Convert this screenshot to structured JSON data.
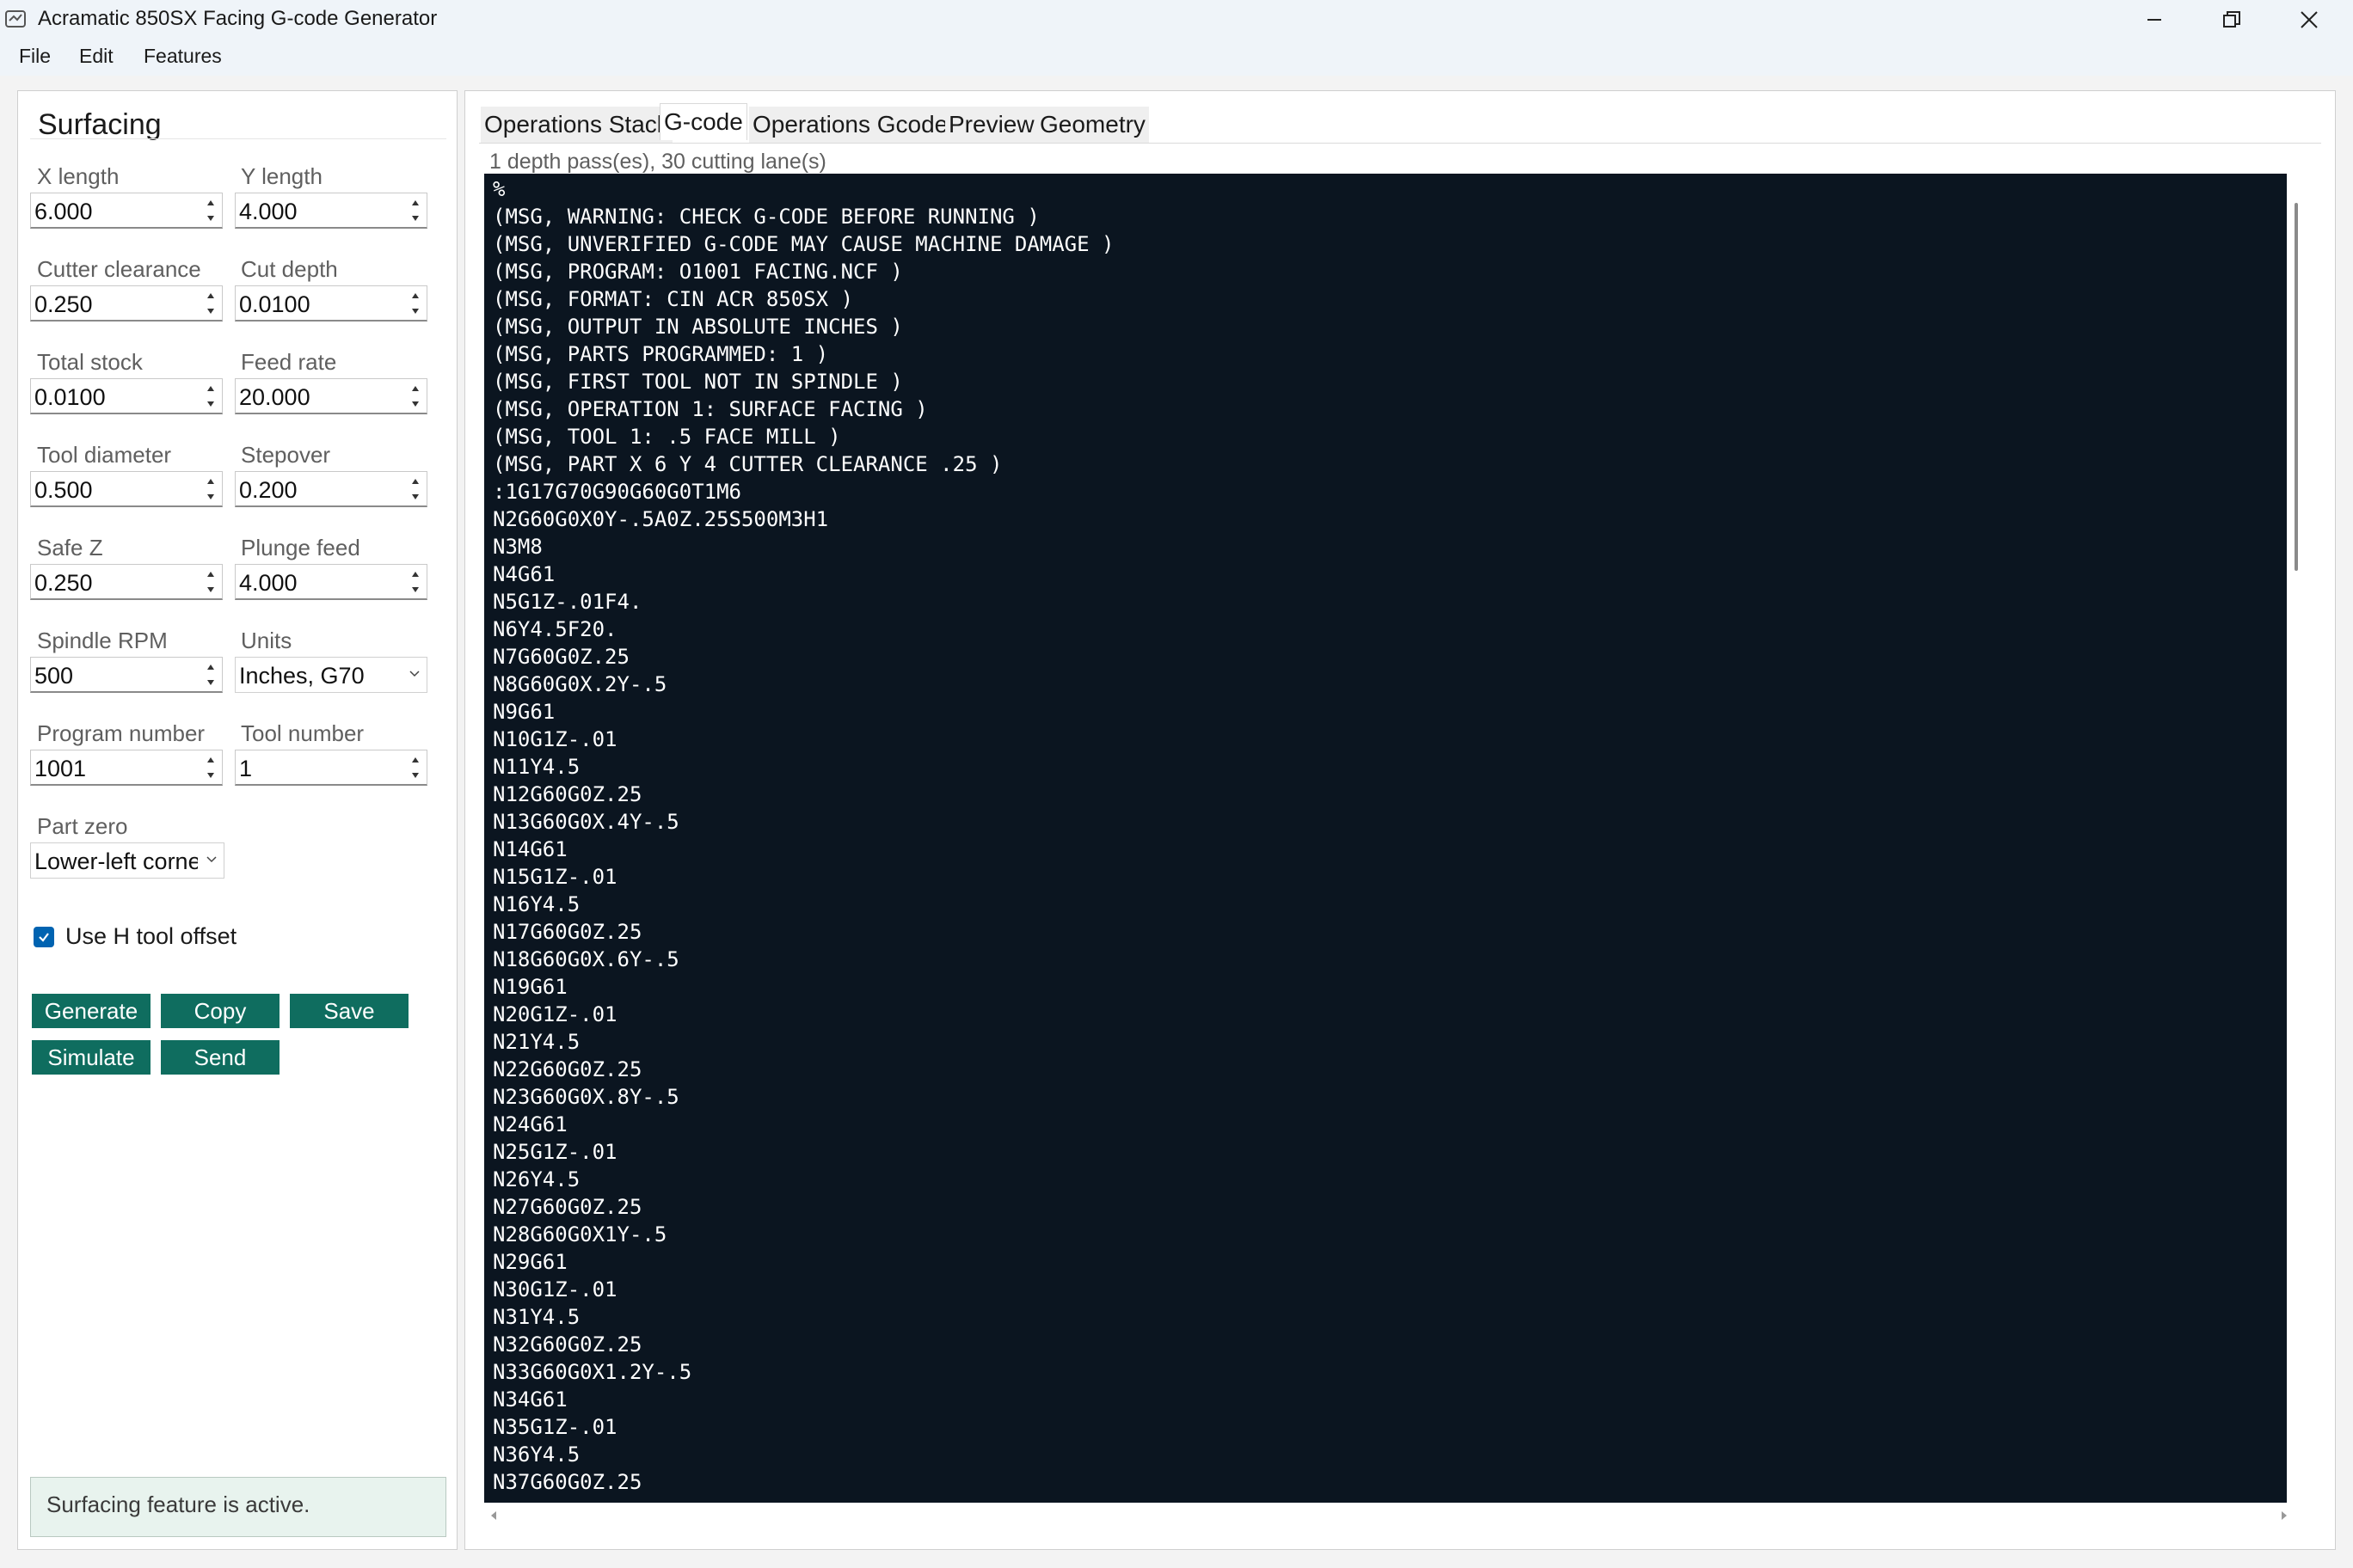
{
  "window": {
    "title": "Acramatic 850SX Facing G-code Generator",
    "controls": [
      "minimize-icon",
      "restore-icon",
      "close-icon"
    ]
  },
  "menu": [
    "File",
    "Edit",
    "Features"
  ],
  "left_panel": {
    "title": "Surfacing",
    "fields": {
      "x_length": {
        "label": "X length",
        "value": "6.000"
      },
      "y_length": {
        "label": "Y length",
        "value": "4.000"
      },
      "cutter_clearance": {
        "label": "Cutter clearance",
        "value": "0.250"
      },
      "cut_depth": {
        "label": "Cut depth",
        "value": "0.0100"
      },
      "total_stock": {
        "label": "Total stock",
        "value": "0.0100"
      },
      "feed_rate": {
        "label": "Feed rate",
        "value": "20.000"
      },
      "tool_diameter": {
        "label": "Tool diameter",
        "value": "0.500"
      },
      "stepover": {
        "label": "Stepover",
        "value": "0.200"
      },
      "safe_z": {
        "label": "Safe Z",
        "value": "0.250"
      },
      "plunge_feed": {
        "label": "Plunge feed",
        "value": "4.000"
      },
      "spindle_rpm": {
        "label": "Spindle RPM",
        "value": "500"
      },
      "units": {
        "label": "Units",
        "value": "Inches, G70"
      },
      "program_number": {
        "label": "Program number",
        "value": "1001"
      },
      "tool_number": {
        "label": "Tool number",
        "value": "1"
      },
      "part_zero": {
        "label": "Part zero",
        "value": "Lower-left corner"
      }
    },
    "use_h_offset": {
      "label": "Use H tool offset",
      "checked": true
    },
    "buttons": {
      "generate": "Generate",
      "copy": "Copy",
      "save": "Save",
      "simulate": "Simulate",
      "send": "Send"
    },
    "status": "Surfacing feature is active."
  },
  "right_panel": {
    "tabs": [
      "Operations Stack",
      "G-code",
      "Operations Gcode",
      "Preview",
      "Geometry"
    ],
    "active_tab": "G-code",
    "info": "1 depth pass(es), 30 cutting lane(s)",
    "gcode_lines": [
      "%",
      "(MSG, WARNING: CHECK G-CODE BEFORE RUNNING )",
      "(MSG, UNVERIFIED G-CODE MAY CAUSE MACHINE DAMAGE )",
      "(MSG, PROGRAM: O1001 FACING.NCF )",
      "(MSG, FORMAT: CIN ACR 850SX )",
      "(MSG, OUTPUT IN ABSOLUTE INCHES )",
      "(MSG, PARTS PROGRAMMED: 1 )",
      "(MSG, FIRST TOOL NOT IN SPINDLE )",
      "(MSG, OPERATION 1: SURFACE FACING )",
      "(MSG, TOOL 1: .5 FACE MILL )",
      "(MSG, PART X 6 Y 4 CUTTER CLEARANCE .25 )",
      ":1G17G70G90G60G0T1M6",
      "N2G60G0X0Y-.5A0Z.25S500M3H1",
      "N3M8",
      "N4G61",
      "N5G1Z-.01F4.",
      "N6Y4.5F20.",
      "N7G60G0Z.25",
      "N8G60G0X.2Y-.5",
      "N9G61",
      "N10G1Z-.01",
      "N11Y4.5",
      "N12G60G0Z.25",
      "N13G60G0X.4Y-.5",
      "N14G61",
      "N15G1Z-.01",
      "N16Y4.5",
      "N17G60G0Z.25",
      "N18G60G0X.6Y-.5",
      "N19G61",
      "N20G1Z-.01",
      "N21Y4.5",
      "N22G60G0Z.25",
      "N23G60G0X.8Y-.5",
      "N24G61",
      "N25G1Z-.01",
      "N26Y4.5",
      "N27G60G0Z.25",
      "N28G60G0X1Y-.5",
      "N29G61",
      "N30G1Z-.01",
      "N31Y4.5",
      "N32G60G0Z.25",
      "N33G60G0X1.2Y-.5",
      "N34G61",
      "N35G1Z-.01",
      "N36Y4.5",
      "N37G60G0Z.25"
    ]
  },
  "colors": {
    "accent_button": "#0f6d5f",
    "code_background": "#0b1520",
    "checkbox": "#0063b1",
    "status_background": "#e8f3ee"
  }
}
